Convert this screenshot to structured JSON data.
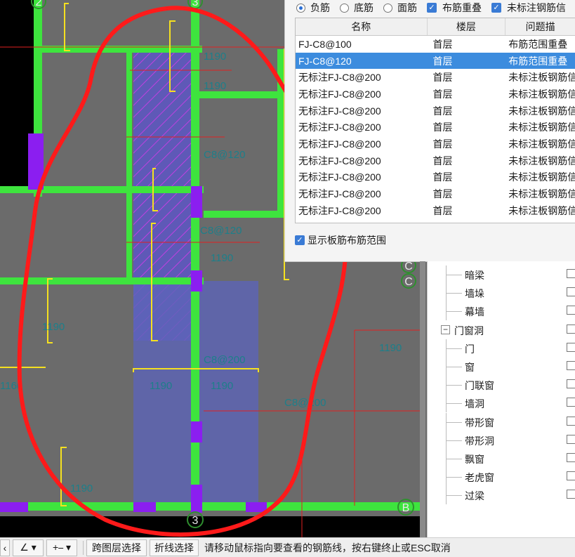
{
  "dialog": {
    "options": [
      {
        "type": "radio",
        "label": "负筋",
        "checked": true
      },
      {
        "type": "radio",
        "label": "底筋",
        "checked": false
      },
      {
        "type": "radio",
        "label": "面筋",
        "checked": false
      },
      {
        "type": "checkbox",
        "label": "布筋重叠",
        "checked": true
      },
      {
        "type": "checkbox",
        "label": "未标注钢筋信",
        "checked": true
      }
    ],
    "columns": [
      "名称",
      "楼层",
      "问题描"
    ],
    "rows": [
      {
        "name": "FJ-C8@100",
        "floor": "首层",
        "issue": "布筋范围重叠",
        "selected": false
      },
      {
        "name": "FJ-C8@120",
        "floor": "首层",
        "issue": "布筋范围重叠",
        "selected": true
      },
      {
        "name": "无标注FJ-C8@200",
        "floor": "首层",
        "issue": "未标注板钢筋信",
        "selected": false
      },
      {
        "name": "无标注FJ-C8@200",
        "floor": "首层",
        "issue": "未标注板钢筋信",
        "selected": false
      },
      {
        "name": "无标注FJ-C8@200",
        "floor": "首层",
        "issue": "未标注板钢筋信",
        "selected": false
      },
      {
        "name": "无标注FJ-C8@200",
        "floor": "首层",
        "issue": "未标注板钢筋信",
        "selected": false
      },
      {
        "name": "无标注FJ-C8@200",
        "floor": "首层",
        "issue": "未标注板钢筋信",
        "selected": false
      },
      {
        "name": "无标注FJ-C8@200",
        "floor": "首层",
        "issue": "未标注板钢筋信",
        "selected": false
      },
      {
        "name": "无标注FJ-C8@200",
        "floor": "首层",
        "issue": "未标注板钢筋信",
        "selected": false
      },
      {
        "name": "无标注FJ-C8@200",
        "floor": "首层",
        "issue": "未标注板钢筋信",
        "selected": false
      },
      {
        "name": "无标注FJ-C8@200",
        "floor": "首层",
        "issue": "未标注板钢筋信",
        "selected": false
      }
    ],
    "show_range_label": "显示板筋布筋范围"
  },
  "tree": {
    "items": [
      {
        "label": "暗梁",
        "group": false
      },
      {
        "label": "墙垛",
        "group": false
      },
      {
        "label": "幕墙",
        "group": false
      },
      {
        "label": "门窗洞",
        "group": true
      },
      {
        "label": "门",
        "group": false
      },
      {
        "label": "窗",
        "group": false
      },
      {
        "label": "门联窗",
        "group": false
      },
      {
        "label": "墙洞",
        "group": false
      },
      {
        "label": "带形窗",
        "group": false
      },
      {
        "label": "带形洞",
        "group": false
      },
      {
        "label": "飘窗",
        "group": false
      },
      {
        "label": "老虎窗",
        "group": false
      },
      {
        "label": "过梁",
        "group": false
      }
    ]
  },
  "status": {
    "cross_floor": "跨图层选择",
    "polyline": "折线选择",
    "message": "请移动鼠标指向要查看的钢筋线，按右键终止或ESC取消"
  },
  "cad": {
    "axis_labels": [
      "2",
      "3",
      "C",
      "C",
      "B",
      "3"
    ],
    "rebar_labels": [
      "1190",
      "1190",
      "1190",
      "1190",
      "1160",
      "C8@200",
      "C8@120",
      "C8@200",
      "C8@120",
      "1190",
      "1190",
      "1190",
      "1190"
    ]
  }
}
